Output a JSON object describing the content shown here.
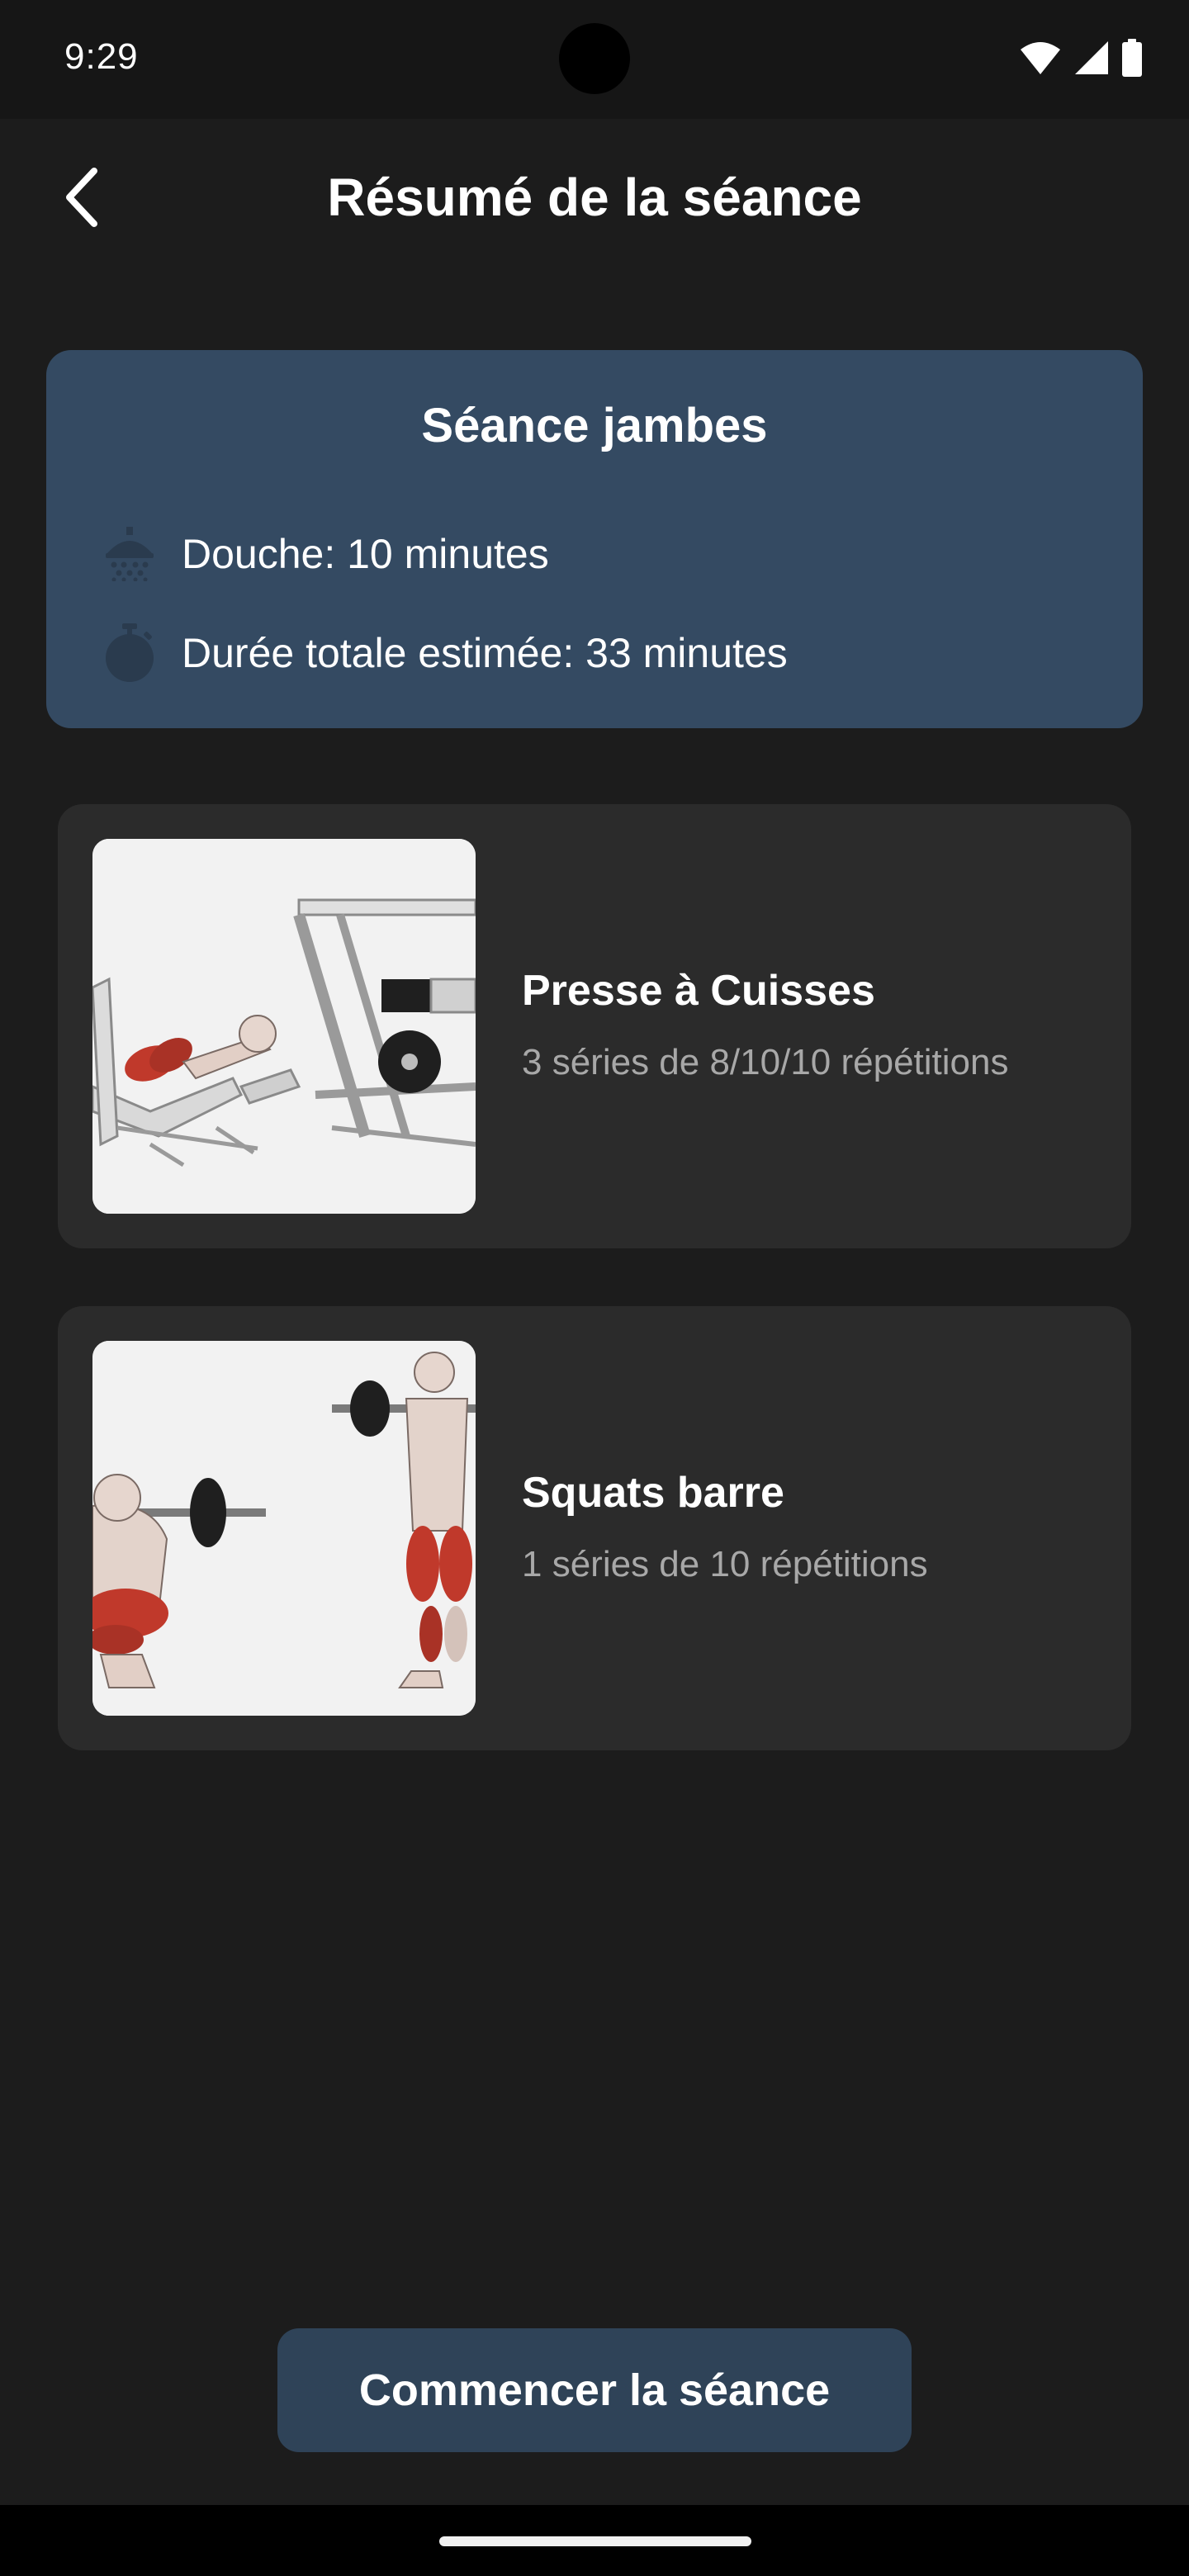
{
  "status_bar": {
    "time": "9:29",
    "icons": [
      "wifi-icon",
      "signal-icon",
      "battery-icon"
    ]
  },
  "header": {
    "title": "Résumé de la séance",
    "back_icon": "chevron-left-icon"
  },
  "summary": {
    "title": "Séance jambes",
    "shower_icon": "shower-icon",
    "shower_text": "Douche: 10 minutes",
    "duration_icon": "stopwatch-icon",
    "duration_text": "Durée totale estimée: 33 minutes",
    "background_color": "#344a62"
  },
  "exercises": [
    {
      "name": "Presse à Cuisses",
      "detail": "3 séries de 8/10/10 répétitions",
      "image": "leg-press-illustration"
    },
    {
      "name": "Squats barre",
      "detail": "1 séries de 10 répétitions",
      "image": "barbell-squat-illustration"
    }
  ],
  "start_button": {
    "label": "Commencer la séance",
    "background_color": "#2f4358"
  },
  "colors": {
    "background": "#1c1c1c",
    "card": "#2b2b2b",
    "muted_text": "#a8a8a8",
    "muscle_highlight": "#c0392b"
  }
}
